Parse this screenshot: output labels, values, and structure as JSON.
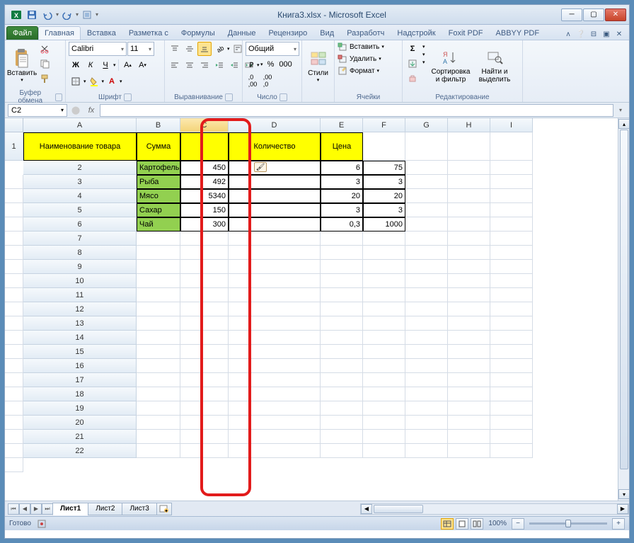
{
  "window_title": "Книга3.xlsx - Microsoft Excel",
  "tabs": {
    "file": "Файл",
    "list": [
      "Главная",
      "Вставка",
      "Разметка с",
      "Формулы",
      "Данные",
      "Рецензиро",
      "Вид",
      "Разработч",
      "Надстройк",
      "Foxit PDF",
      "ABBYY PDF"
    ],
    "active": 0
  },
  "ribbon": {
    "clipboard": {
      "label": "Буфер обмена",
      "paste": "Вставить"
    },
    "font": {
      "label": "Шрифт",
      "name": "Calibri",
      "size": "11"
    },
    "alignment": {
      "label": "Выравнивание"
    },
    "number": {
      "label": "Число",
      "format": "Общий"
    },
    "styles": {
      "label": "Стили",
      "btn": "Стили"
    },
    "cells": {
      "label": "Ячейки",
      "insert": "Вставить",
      "delete": "Удалить",
      "format": "Формат"
    },
    "editing": {
      "label": "Редактирование",
      "sort": "Сортировка\nи фильтр",
      "find": "Найти и\nвыделить"
    }
  },
  "namebox": "C2",
  "columns": [
    "A",
    "B",
    "C",
    "D",
    "E",
    "F",
    "G",
    "H",
    "I"
  ],
  "rows": [
    "1",
    "2",
    "3",
    "4",
    "5",
    "6",
    "7",
    "8",
    "9",
    "10",
    "11",
    "12",
    "13",
    "14",
    "15",
    "16",
    "17",
    "18",
    "19",
    "20",
    "21",
    "22"
  ],
  "table": {
    "headers": {
      "A": "Наименование товара",
      "B": "Сумма",
      "C": "",
      "D": "Количество",
      "E": "Цена"
    },
    "data": [
      {
        "name": "Картофель",
        "sum": "450",
        "qty": "6",
        "price": "75"
      },
      {
        "name": "Рыба",
        "sum": "492",
        "qty": "3",
        "price": "3"
      },
      {
        "name": "Мясо",
        "sum": "5340",
        "qty": "20",
        "price": "20"
      },
      {
        "name": "Сахар",
        "sum": "150",
        "qty": "3",
        "price": "3"
      },
      {
        "name": "Чай",
        "sum": "300",
        "qty": "0,3",
        "price": "1000"
      }
    ]
  },
  "sheets": [
    "Лист1",
    "Лист2",
    "Лист3"
  ],
  "status": {
    "ready": "Готово",
    "zoom": "100%"
  }
}
